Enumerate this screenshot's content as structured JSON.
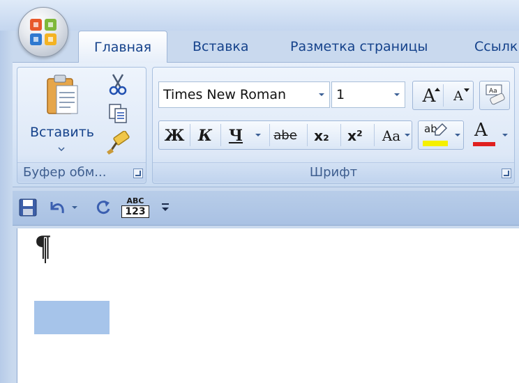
{
  "tabs": [
    {
      "label": "Главная",
      "active": true
    },
    {
      "label": "Вставка",
      "active": false
    },
    {
      "label": "Разметка страницы",
      "active": false
    },
    {
      "label": "Ссылк",
      "active": false
    }
  ],
  "clipboard": {
    "paste_label": "Вставить",
    "group_label": "Буфер обм..."
  },
  "font": {
    "group_label": "Шрифт",
    "font_name": "Times New Roman",
    "font_size": "1",
    "bold_label": "Ж",
    "italic_label": "К",
    "underline_label": "Ч",
    "strike_label": "abe",
    "subscript_label": "x₂",
    "superscript_label": "x²",
    "case_label": "Aa",
    "grow_label": "A",
    "shrink_label": "A",
    "highlight_label": "ab",
    "font_color_label": "A",
    "highlight_color": "#f5f000",
    "font_color": "#e02020"
  },
  "qat": {
    "spell_line1": "ABC",
    "spell_line2": "123"
  },
  "document": {
    "paragraph_mark": "¶"
  },
  "colors": {
    "accent": "#15428b",
    "selection": "#a6c4ea"
  }
}
